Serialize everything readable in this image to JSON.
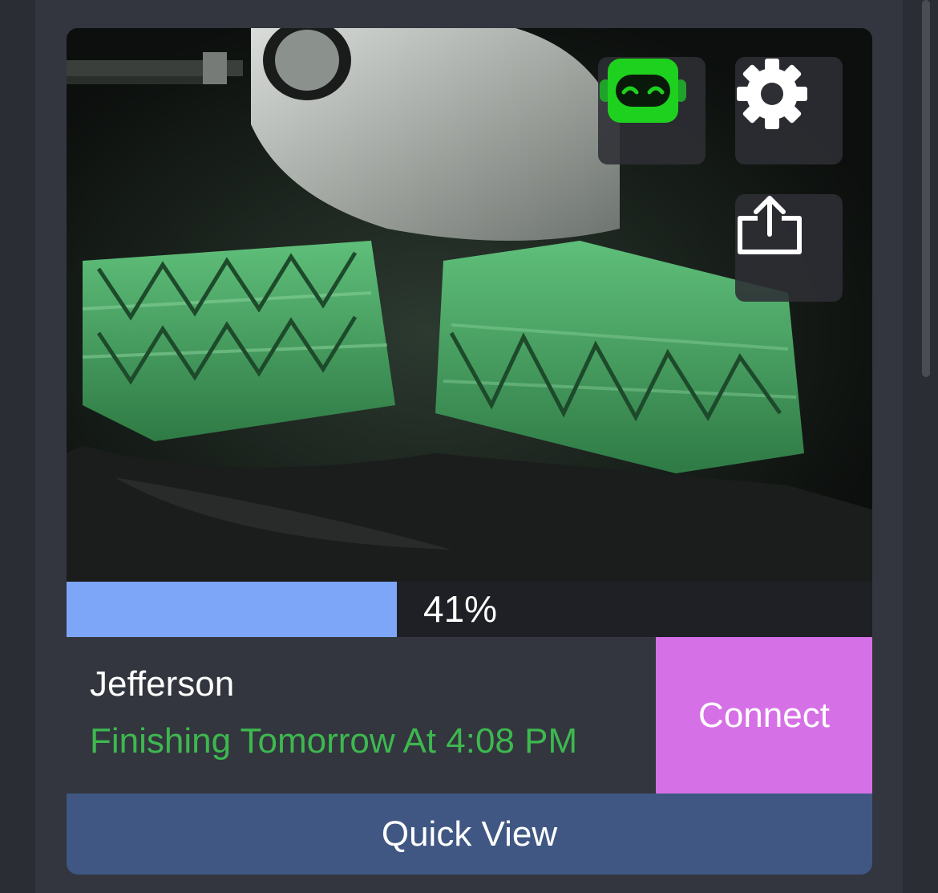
{
  "printer": {
    "name": "Jefferson",
    "status": "Finishing Tomorrow At 4:08 PM",
    "progress_label": "41%",
    "progress_fraction": 0.41
  },
  "actions": {
    "connect_label": "Connect",
    "quick_view_label": "Quick View"
  },
  "icons": {
    "robot": "robot-icon",
    "settings": "gear-icon",
    "share": "share-icon"
  },
  "colors": {
    "progress_fill": "#7ea6f8",
    "status_text": "#3db84f",
    "connect_button": "#d670e6",
    "quick_view_button": "#3f5782",
    "robot_icon": "#1fd11f"
  }
}
